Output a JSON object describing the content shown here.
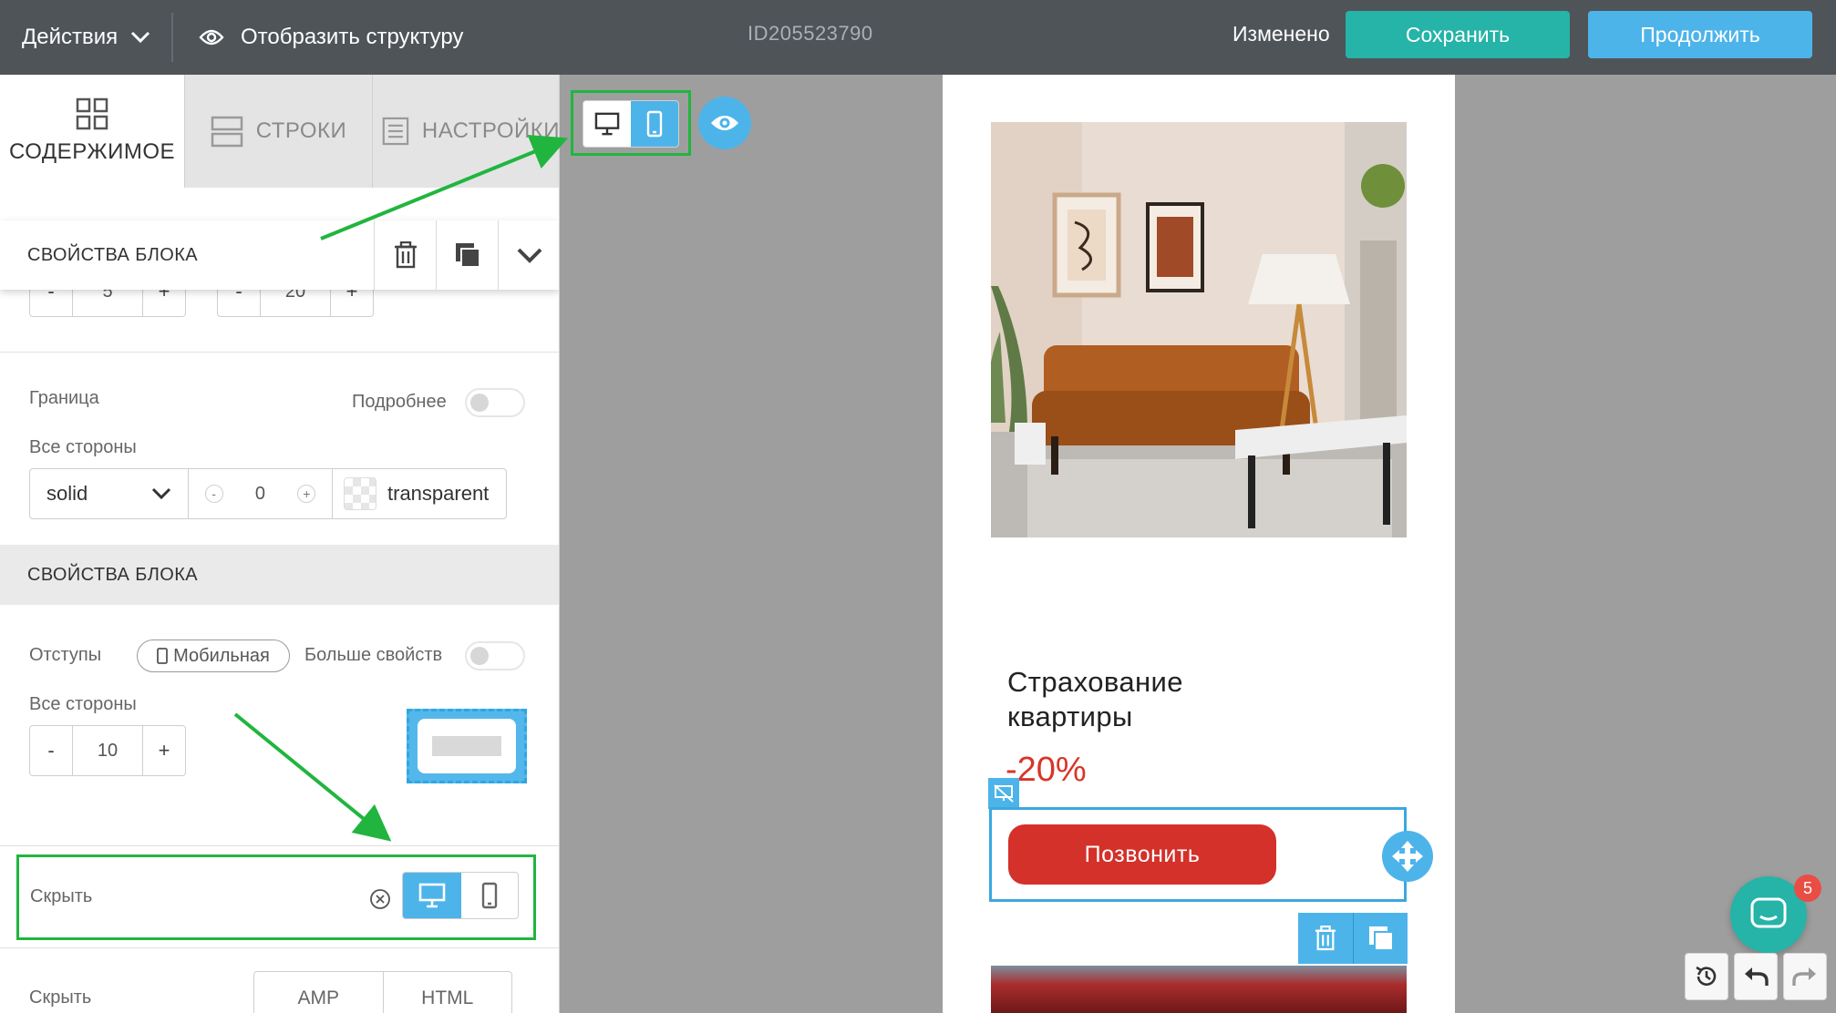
{
  "topbar": {
    "actions_label": "Действия",
    "structure_label": "Отобразить структуру",
    "doc_id": "ID205523790",
    "status": "Изменено",
    "save_label": "Сохранить",
    "continue_label": "Продолжить"
  },
  "tabs": {
    "content": "СОДЕРЖИМОЕ",
    "rows": "СТРОКИ",
    "settings": "НАСТРОЙКИ"
  },
  "block_props": {
    "title": "СВОЙСТВА БЛОКА",
    "stepper1_value": "5",
    "stepper2_value": "20"
  },
  "border": {
    "label": "Граница",
    "details_label": "Подробнее",
    "all_sides_label": "Все стороны",
    "style_value": "solid",
    "width_value": "0",
    "color_value": "transparent"
  },
  "block_props2": {
    "title": "СВОЙСТВА БЛОКА",
    "padding_label": "Отступы",
    "mobile_pill": "Мобильная",
    "more_props_label": "Больше свойств",
    "all_sides_label": "Все стороны",
    "padding_value": "10"
  },
  "hide": {
    "label": "Скрыть",
    "active_device": "desktop"
  },
  "hide2": {
    "label": "Скрыть",
    "opt_amp": "AMP",
    "opt_html": "HTML"
  },
  "editor": {
    "active_device": "mobile"
  },
  "email": {
    "title": "Страхование квартиры",
    "discount": "-20%",
    "cta_label": "Позвонить"
  },
  "chat": {
    "badge_count": "5"
  },
  "colors": {
    "topbar_bg": "#4f5459",
    "save_button": "#26b3a8",
    "continue_button": "#4db4ea",
    "cta_red": "#d3312a",
    "highlight_green": "#21b53f"
  }
}
